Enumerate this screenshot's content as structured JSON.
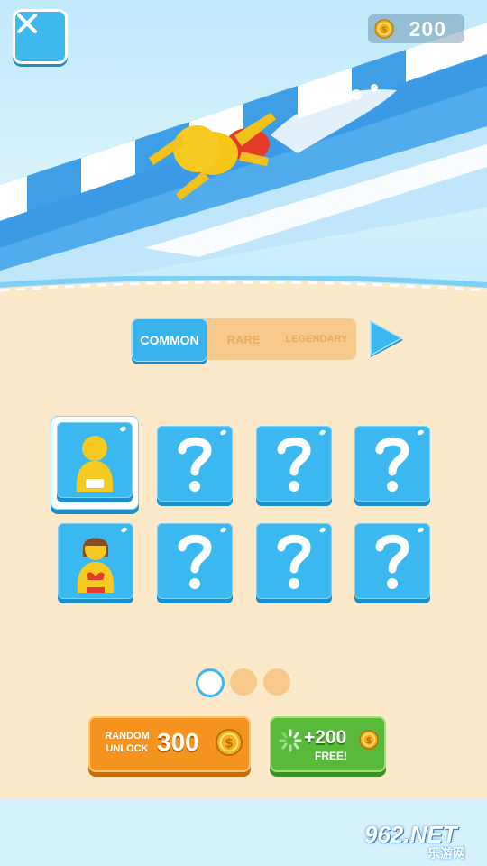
{
  "header": {
    "close_icon": "close-x-icon",
    "coins": "200",
    "coin_icon": "gold-coin-icon"
  },
  "tabs": [
    {
      "label": "COMMON",
      "active": true
    },
    {
      "label": "RARE",
      "active": false
    },
    {
      "label": "LEGENDARY",
      "active": false
    }
  ],
  "next_icon": "play-arrow-icon",
  "grid": {
    "items": [
      {
        "state": "unlocked",
        "icon": "yellow-character-icon",
        "selected": true
      },
      {
        "state": "locked",
        "icon": "question-mark-icon"
      },
      {
        "state": "locked",
        "icon": "question-mark-icon"
      },
      {
        "state": "locked",
        "icon": "question-mark-icon"
      },
      {
        "state": "unlocked",
        "icon": "bikini-character-icon",
        "selected": false
      },
      {
        "state": "locked",
        "icon": "question-mark-icon"
      },
      {
        "state": "locked",
        "icon": "question-mark-icon"
      },
      {
        "state": "locked",
        "icon": "question-mark-icon"
      }
    ]
  },
  "pagination": {
    "current": 1,
    "total": 3
  },
  "random_unlock": {
    "label": "RANDOM UNLOCK",
    "price": "300"
  },
  "free_coins": {
    "amount": "+200",
    "label": "FREE!"
  },
  "watermark": {
    "brand": "962.NET",
    "sub": "乐游网"
  },
  "colors": {
    "accent_blue": "#3bb8ef",
    "orange": "#f5931f",
    "green": "#58ba3a",
    "sand": "#fbe9c9"
  }
}
